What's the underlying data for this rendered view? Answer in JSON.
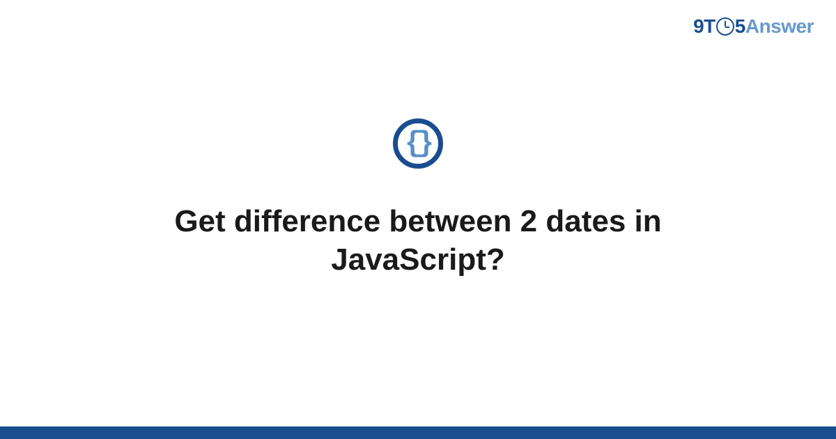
{
  "logo": {
    "part1": "9T",
    "part2": "5",
    "part3": "Answer"
  },
  "icon": {
    "glyph": "{}"
  },
  "title": "Get difference between 2 dates in JavaScript?"
}
